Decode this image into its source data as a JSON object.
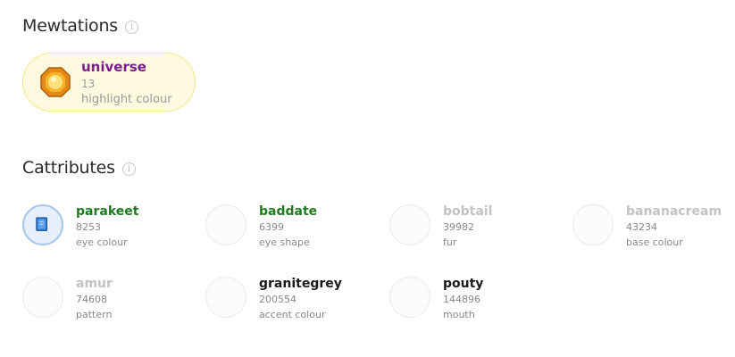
{
  "mewtations": {
    "title": "Mewtations",
    "info_icon": "i",
    "item": {
      "name": "universe",
      "count": "13",
      "type": "highlight colour",
      "name_color": "#7a1f8a"
    }
  },
  "cattributes": {
    "title": "Cattributes",
    "info_icon": "i",
    "items": [
      {
        "name": "parakeet",
        "count": "8253",
        "type": "eye colour",
        "name_color": "#1e7b1e",
        "icon": "book-icon"
      },
      {
        "name": "baddate",
        "count": "6399",
        "type": "eye shape",
        "name_color": "#1e7b1e"
      },
      {
        "name": "bobtail",
        "count": "39982",
        "type": "fur",
        "name_color": "#c3c3c3"
      },
      {
        "name": "bananacream",
        "count": "43234",
        "type": "base colour",
        "name_color": "#c3c3c3"
      },
      {
        "name": "amur",
        "count": "74608",
        "type": "pattern",
        "name_color": "#c3c3c3"
      },
      {
        "name": "granitegrey",
        "count": "200554",
        "type": "accent colour",
        "name_color": "#1a1a1a"
      },
      {
        "name": "pouty",
        "count": "144896",
        "type": "mouth",
        "name_color": "#1a1a1a"
      }
    ]
  }
}
